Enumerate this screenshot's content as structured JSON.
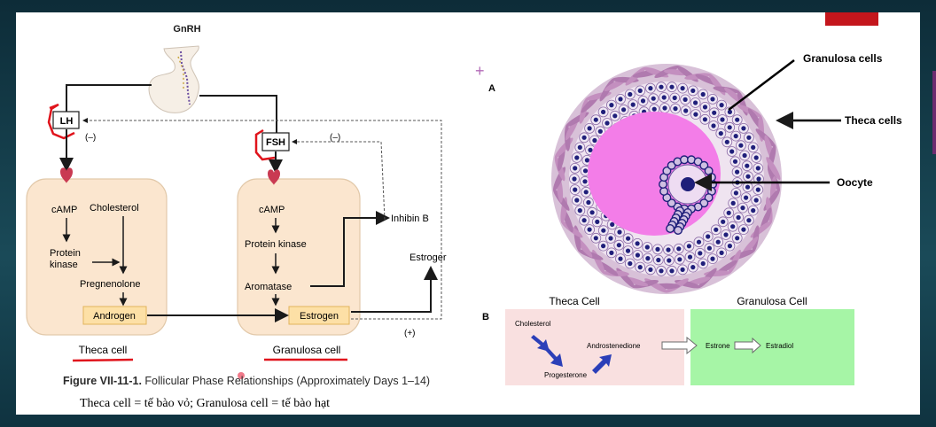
{
  "left_diagram": {
    "gnrh": "GnRH",
    "lh": "LH",
    "fsh": "FSH",
    "neg_left": "(–)",
    "neg_right": "(–)",
    "pos": "(+)",
    "theca": {
      "camp": "cAMP",
      "cholesterol": "Cholesterol",
      "protein_kinase_1": "Protein",
      "protein_kinase_2": "kinase",
      "pregnenolone": "Pregnenolone",
      "androgen": "Androgen",
      "label": "Theca cell"
    },
    "granulosa": {
      "camp": "cAMP",
      "protein_kinase": "Protein kinase",
      "aromatase": "Aromatase",
      "estrogen": "Estrogen",
      "label": "Granulosa cell"
    },
    "inhibin": "Inhibin B",
    "estroger": "Estroger"
  },
  "caption": {
    "figure_no": "Figure VII-11-1.",
    "text": "Follicular Phase Relationships (Approximately Days 1–14)",
    "vietnamese": "Theca cell = tế bào vỏ; Granulosa cell = tế bào hạt"
  },
  "right_diagram": {
    "label_a": "A",
    "granulosa_cells": "Granulosa cells",
    "theca_cells": "Theca cells",
    "oocyte": "Oocyte",
    "label_b": "B",
    "theca_cell_title": "Theca Cell",
    "granulosa_cell_title": "Granulosa Cell",
    "cholesterol": "Cholesterol",
    "progesterone": "Progesterone",
    "androstenedione": "Androstenedione",
    "estrone": "Estrone",
    "estradiol": "Estradiol"
  },
  "colors": {
    "cell_fill": "#fbe6cf",
    "antrum": "#f37de8",
    "granulosa_nucleus": "#1f1f7a",
    "theca_pink": "#f9e0e0",
    "granulosa_green": "#a6f5a6",
    "flow_arrow": "#2b3fb8",
    "red_marker": "#e0141c"
  }
}
